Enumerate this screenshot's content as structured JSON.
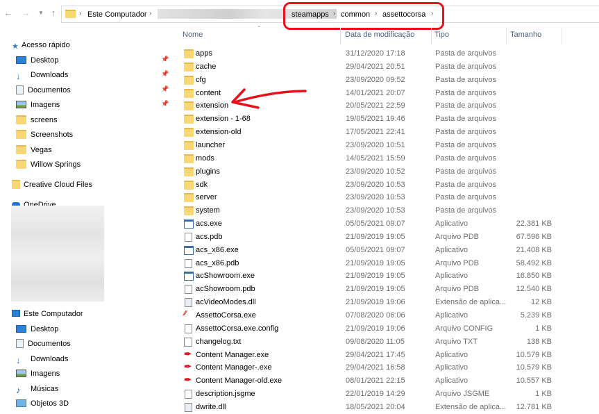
{
  "address": {
    "crumbs": [
      "Este Computador",
      "steamapps",
      "common",
      "assettocorsa"
    ]
  },
  "nav": {
    "quick_access": "Acesso rápido",
    "quick_items": [
      "Desktop",
      "Downloads",
      "Documentos",
      "Imagens",
      "screens",
      "Screenshots",
      "Vegas",
      "Willow Springs"
    ],
    "creative_cloud": "Creative Cloud Files",
    "onedrive": "OneDrive",
    "this_pc": "Este Computador",
    "pc_items": [
      "Desktop",
      "Documentos",
      "Downloads",
      "Imagens",
      "Músicas",
      "Objetos 3D"
    ]
  },
  "columns": {
    "name": "Nome",
    "date": "Data de modificação",
    "type": "Tipo",
    "size": "Tamanho"
  },
  "files": [
    {
      "name": "apps",
      "date": "31/12/2020 17:18",
      "type": "Pasta de arquivos",
      "size": "",
      "icon": "folder-icon"
    },
    {
      "name": "cache",
      "date": "29/04/2021 20:51",
      "type": "Pasta de arquivos",
      "size": "",
      "icon": "folder-icon"
    },
    {
      "name": "cfg",
      "date": "23/09/2020 09:52",
      "type": "Pasta de arquivos",
      "size": "",
      "icon": "folder-icon"
    },
    {
      "name": "content",
      "date": "14/01/2021 20:07",
      "type": "Pasta de arquivos",
      "size": "",
      "icon": "folder-icon"
    },
    {
      "name": "extension",
      "date": "20/05/2021 22:59",
      "type": "Pasta de arquivos",
      "size": "",
      "icon": "folder-icon"
    },
    {
      "name": "extension - 1-68",
      "date": "19/05/2021 19:46",
      "type": "Pasta de arquivos",
      "size": "",
      "icon": "folder-icon"
    },
    {
      "name": "extension-old",
      "date": "17/05/2021 22:41",
      "type": "Pasta de arquivos",
      "size": "",
      "icon": "folder-icon"
    },
    {
      "name": "launcher",
      "date": "23/09/2020 10:51",
      "type": "Pasta de arquivos",
      "size": "",
      "icon": "folder-icon"
    },
    {
      "name": "mods",
      "date": "14/05/2021 15:59",
      "type": "Pasta de arquivos",
      "size": "",
      "icon": "folder-icon"
    },
    {
      "name": "plugins",
      "date": "23/09/2020 10:52",
      "type": "Pasta de arquivos",
      "size": "",
      "icon": "folder-icon"
    },
    {
      "name": "sdk",
      "date": "23/09/2020 10:53",
      "type": "Pasta de arquivos",
      "size": "",
      "icon": "folder-icon"
    },
    {
      "name": "server",
      "date": "23/09/2020 10:53",
      "type": "Pasta de arquivos",
      "size": "",
      "icon": "folder-icon"
    },
    {
      "name": "system",
      "date": "23/09/2020 10:53",
      "type": "Pasta de arquivos",
      "size": "",
      "icon": "folder-icon"
    },
    {
      "name": "acs.exe",
      "date": "05/05/2021 09:07",
      "type": "Aplicativo",
      "size": "22.381 KB",
      "icon": "exe-icon"
    },
    {
      "name": "acs.pdb",
      "date": "21/09/2019 19:05",
      "type": "Arquivo PDB",
      "size": "67.596 KB",
      "icon": "file-icon"
    },
    {
      "name": "acs_x86.exe",
      "date": "05/05/2021 09:07",
      "type": "Aplicativo",
      "size": "21.408 KB",
      "icon": "exe-icon"
    },
    {
      "name": "acs_x86.pdb",
      "date": "21/09/2019 19:05",
      "type": "Arquivo PDB",
      "size": "58.492 KB",
      "icon": "file-icon"
    },
    {
      "name": "acShowroom.exe",
      "date": "21/09/2019 19:05",
      "type": "Aplicativo",
      "size": "16.850 KB",
      "icon": "exe-icon"
    },
    {
      "name": "acShowroom.pdb",
      "date": "21/09/2019 19:05",
      "type": "Arquivo PDB",
      "size": "12.540 KB",
      "icon": "file-icon"
    },
    {
      "name": "acVideoModes.dll",
      "date": "21/09/2019 19:06",
      "type": "Extensão de aplica...",
      "size": "12 KB",
      "icon": "dll-icon"
    },
    {
      "name": "AssettoCorsa.exe",
      "date": "07/08/2020 06:06",
      "type": "Aplicativo",
      "size": "5.239 KB",
      "icon": "assettocorsa-icon"
    },
    {
      "name": "AssettoCorsa.exe.config",
      "date": "21/09/2019 19:06",
      "type": "Arquivo CONFIG",
      "size": "1 KB",
      "icon": "file-icon"
    },
    {
      "name": "changelog.txt",
      "date": "09/08/2020 11:05",
      "type": "Arquivo TXT",
      "size": "138 KB",
      "icon": "text-file-icon"
    },
    {
      "name": "Content Manager.exe",
      "date": "29/04/2021 17:45",
      "type": "Aplicativo",
      "size": "10.579 KB",
      "icon": "content-manager-icon"
    },
    {
      "name": "Content Manager-.exe",
      "date": "29/04/2021 16:58",
      "type": "Aplicativo",
      "size": "10.579 KB",
      "icon": "content-manager-icon"
    },
    {
      "name": "Content Manager-old.exe",
      "date": "08/01/2021 22:15",
      "type": "Aplicativo",
      "size": "10.557 KB",
      "icon": "content-manager-icon"
    },
    {
      "name": "description.jsgme",
      "date": "22/01/2019 14:29",
      "type": "Arquivo JSGME",
      "size": "1 KB",
      "icon": "file-icon"
    },
    {
      "name": "dwrite.dll",
      "date": "18/05/2021 20:04",
      "type": "Extensão de aplica...",
      "size": "12.781 KB",
      "icon": "dll-icon"
    }
  ],
  "colors": {
    "annotation": "#e6131d",
    "folder": "#f8d775",
    "header_text": "#4c607a"
  }
}
